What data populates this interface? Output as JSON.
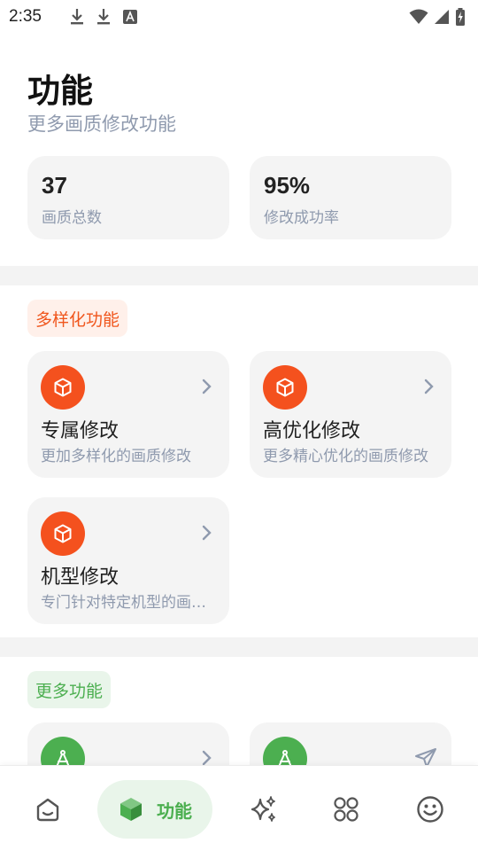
{
  "status_bar": {
    "time": "2:35",
    "icons": [
      "download-icon",
      "download-icon",
      "font-notification-icon",
      "wifi-icon",
      "signal-icon",
      "battery-charging-icon"
    ]
  },
  "header": {
    "title": "功能",
    "subtitle": "更多画质修改功能"
  },
  "stats": [
    {
      "value": "37",
      "label": "画质总数"
    },
    {
      "value": "95%",
      "label": "修改成功率"
    }
  ],
  "sections": [
    {
      "tag": "多样化功能",
      "color": "#f0561d",
      "cards": [
        {
          "title": "专属修改",
          "desc": "更加多样化的画质修改",
          "icon": "cube-icon"
        },
        {
          "title": "高优化修改",
          "desc": "更多精心优化的画质修改",
          "icon": "cube-icon"
        },
        {
          "title": "机型修改",
          "desc": "专门针对特定机型的画质修改",
          "icon": "cube-icon"
        }
      ]
    },
    {
      "tag": "更多功能",
      "color": "#4caf50",
      "cards": [
        {
          "icon": "compass-icon",
          "action_icon": "chevron-right-icon"
        },
        {
          "icon": "compass-icon",
          "action_icon": "send-icon"
        }
      ]
    }
  ],
  "bottom_nav": {
    "active_label": "功能",
    "items": [
      "home-icon",
      "package-icon",
      "sparkle-icon",
      "apps-icon",
      "smiley-icon"
    ]
  },
  "colors": {
    "accent_green": "#4caf50",
    "accent_orange": "#f4511e",
    "card_bg": "#f4f4f4",
    "muted_text": "#8f9aae"
  }
}
